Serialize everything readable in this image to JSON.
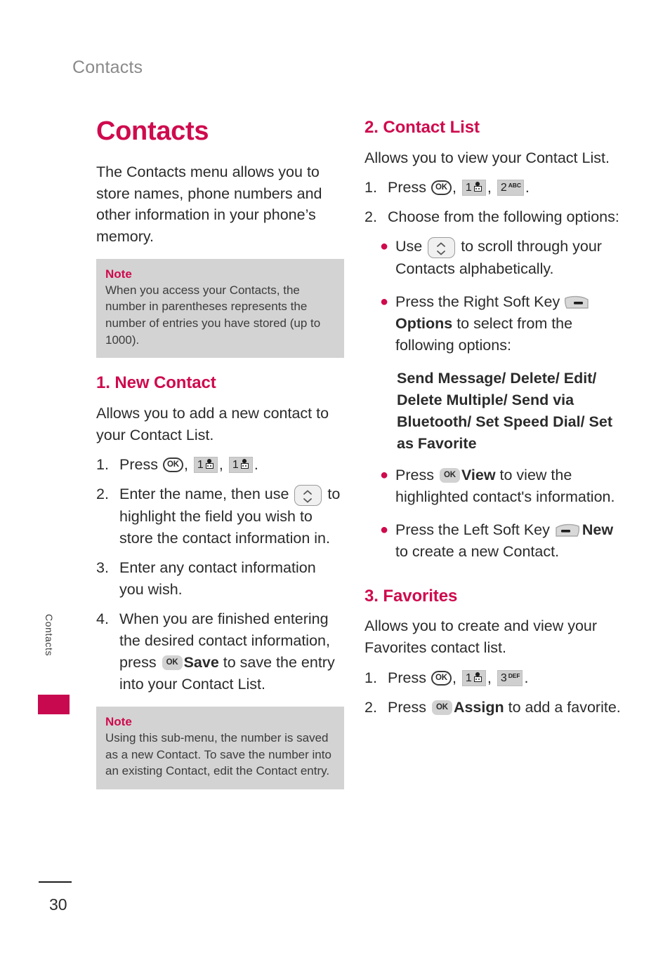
{
  "meta": {
    "accent_crimson": "#cf0a4e",
    "note_bg": "#d3d3d3",
    "header_gray": "#8a8a8a"
  },
  "running_header": "Contacts",
  "side_tab": {
    "label": "Contacts"
  },
  "footer": {
    "page_number": "30"
  },
  "left_column": {
    "doc_title": "Contacts",
    "intro": "The Contacts menu allows you to store names, phone numbers and other information in your phone’s memory.",
    "note_1": {
      "label": "Note",
      "text": "When you access your Contacts, the number in parentheses represents the number of entries you have stored (up to 1000)."
    },
    "section_1": {
      "title": "1. New Contact",
      "body": "Allows you to add a new contact to your Contact List.",
      "steps": [
        {
          "num": "1.",
          "pre": "Press ",
          "keys": [
            "ok",
            "num1",
            "num1"
          ],
          "post": "."
        },
        {
          "num": "2.",
          "pre": "Enter the name, then use ",
          "keys": [
            "scroll"
          ],
          "post": " to highlight the field you wish to store the contact information in."
        },
        {
          "num": "3.",
          "pre": "Enter any contact information you wish.",
          "keys": [],
          "post": ""
        },
        {
          "num": "4.",
          "pre": "When you are finished entering the desired contact information, press ",
          "keys": [
            "ok_fill"
          ],
          "bold": "Save",
          "post": " to save the entry into your Contact List."
        }
      ]
    },
    "note_2": {
      "label": "Note",
      "text": "Using this sub-menu, the number is saved as a new Contact. To save the number into an existing Contact, edit the Contact entry."
    }
  },
  "right_column": {
    "section_2": {
      "title": "2. Contact List",
      "body": "Allows you to view your Contact List.",
      "step_1": {
        "num": "1.",
        "pre": "Press ",
        "keys": [
          "ok",
          "num1",
          "num2"
        ],
        "post": "."
      },
      "step_2": {
        "num": "2.",
        "text": "Choose from the following options:"
      },
      "bullets": [
        {
          "pre": "Use ",
          "key": "scroll",
          "post": " to scroll through your Contacts alphabetically."
        },
        {
          "pre": "Press the Right Soft Key ",
          "key": "soft_right",
          "bold": "Options",
          "post": " to select from the following options:"
        },
        {
          "pre": "Press ",
          "key": "ok_fill",
          "bold": "View",
          "post": " to view the highlighted contact's information."
        },
        {
          "pre": "Press the Left Soft Key ",
          "key": "soft_left",
          "bold": "New",
          "post": " to create a new Contact."
        }
      ],
      "options_text": "Send Message/ Delete/ Edit/ Delete Multiple/ Send via Bluetooth/ Set Speed Dial/ Set as Favorite"
    },
    "section_3": {
      "title": "3. Favorites",
      "body": "Allows you to create and view your Favorites contact list.",
      "steps": [
        {
          "num": "1.",
          "pre": "Press ",
          "keys": [
            "ok",
            "num1",
            "num3"
          ],
          "post": "."
        },
        {
          "num": "2.",
          "pre": "Press ",
          "keys": [
            "ok_fill"
          ],
          "bold": "Assign",
          "post": " to add a favorite."
        }
      ]
    }
  },
  "keys": {
    "ok": {
      "icon": "ok-key-icon",
      "label": "OK"
    },
    "ok_fill": {
      "icon": "ok-key-filled-icon",
      "label": "OK"
    },
    "num1": {
      "icon": "keypad-1-voicemail-icon",
      "digit": "1",
      "sub": ""
    },
    "num2": {
      "icon": "keypad-2-abc-icon",
      "digit": "2",
      "sub": "ABC"
    },
    "num3": {
      "icon": "keypad-3-def-icon",
      "digit": "3",
      "sub": "DEF"
    },
    "scroll": {
      "icon": "scroll-up-down-key-icon"
    },
    "soft_left": {
      "icon": "left-soft-key-icon"
    },
    "soft_right": {
      "icon": "right-soft-key-icon"
    }
  }
}
